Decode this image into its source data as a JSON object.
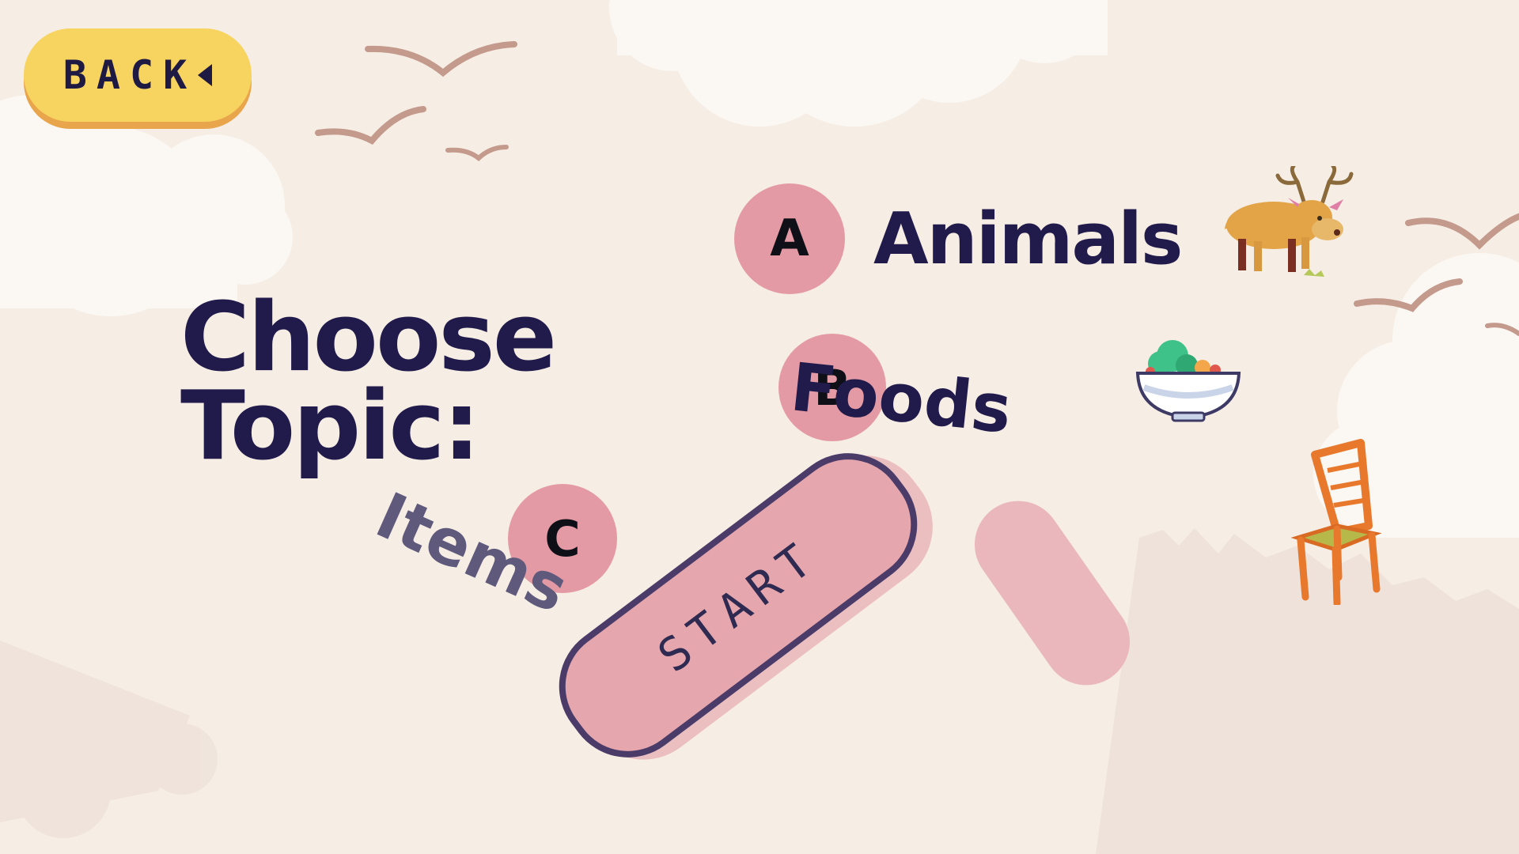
{
  "screen": "topic-select",
  "back_button": {
    "label": "BACK"
  },
  "title": {
    "line1": "Choose",
    "line2": "Topic:"
  },
  "topics": [
    {
      "letter": "A",
      "label": "Animals",
      "icon": "deer-icon"
    },
    {
      "letter": "B",
      "label": "Foods",
      "icon": "salad-bowl-icon"
    },
    {
      "letter": "C",
      "label": "Items",
      "icon": "chair-icon"
    }
  ],
  "start_button": {
    "label": "START"
  },
  "colors": {
    "background": "#f6ede4",
    "back_button": "#f7d35f",
    "back_button_shadow": "#e8a54c",
    "text_dark": "#211b4b",
    "accent_pink": "#e49aa4",
    "bird": "#c39a8c"
  }
}
